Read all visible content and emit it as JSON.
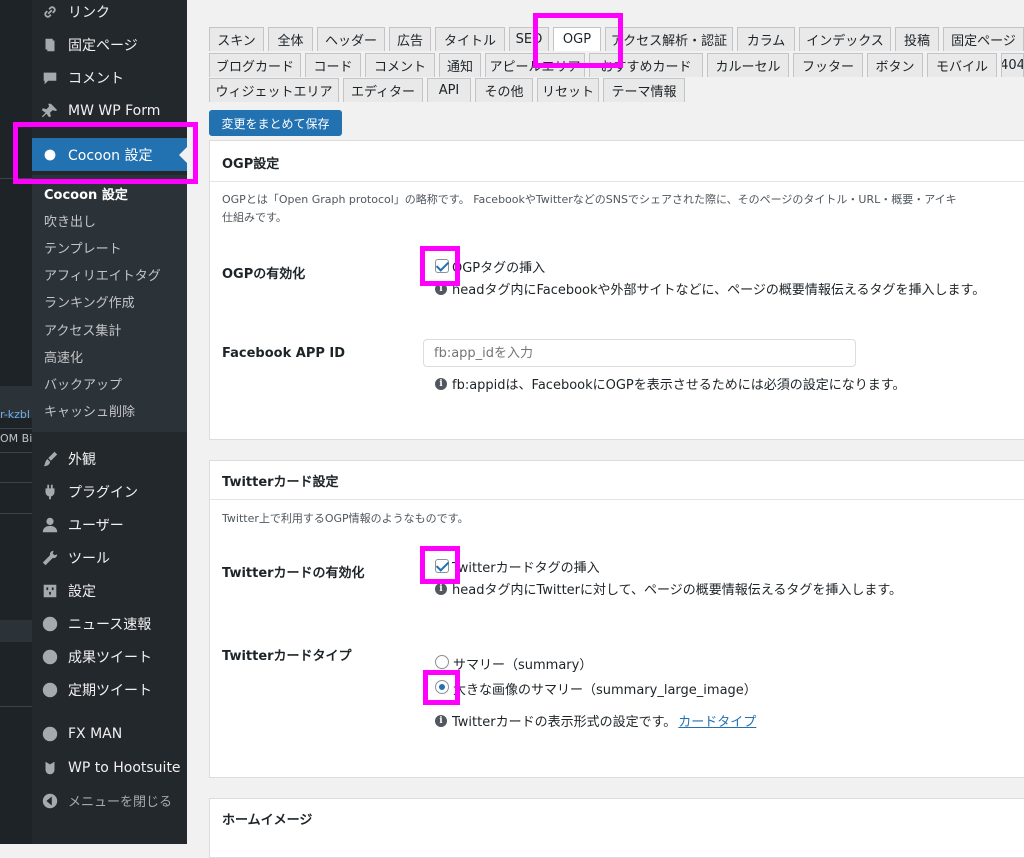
{
  "strip": {
    "text_1": "r-kzbl",
    "text_2": "OM Bi"
  },
  "menu": {
    "items": [
      {
        "label": "リンク",
        "icon": "link-icon"
      },
      {
        "label": "固定ページ",
        "icon": "page-icon"
      },
      {
        "label": "コメント",
        "icon": "comment-icon"
      },
      {
        "label": "MW WP Form",
        "icon": "pin-icon"
      },
      {
        "label": "Cocoon 設定",
        "icon": "circle-icon"
      },
      {
        "label": "外観",
        "icon": "brush-icon"
      },
      {
        "label": "プラグイン",
        "icon": "plugin-icon"
      },
      {
        "label": "ユーザー",
        "icon": "user-icon"
      },
      {
        "label": "ツール",
        "icon": "wrench-icon"
      },
      {
        "label": "設定",
        "icon": "settings-icon"
      },
      {
        "label": "ニュース速報",
        "icon": "globe-icon"
      },
      {
        "label": "成果ツイート",
        "icon": "globe-icon"
      },
      {
        "label": "定期ツイート",
        "icon": "globe-icon"
      },
      {
        "label": "FX MAN",
        "icon": "globe-icon"
      },
      {
        "label": "WP to Hootsuite",
        "icon": "hootsuite-icon"
      },
      {
        "label": "メニューを閉じる",
        "icon": "collapse-icon"
      }
    ],
    "submenu": [
      "Cocoon 設定",
      "吹き出し",
      "テンプレート",
      "アフィリエイトタグ",
      "ランキング作成",
      "アクセス集計",
      "高速化",
      "バックアップ",
      "キャッシュ削除"
    ]
  },
  "tabs": {
    "row1": [
      "スキン",
      "全体",
      "ヘッダー",
      "広告",
      "タイトル",
      "SEO",
      "OGP",
      "アクセス解析・認証",
      "カラム",
      "インデックス",
      "投稿",
      "固定ページ"
    ],
    "row2": [
      "ブログカード",
      "コード",
      "コメント",
      "通知",
      "アピールエリア",
      "おすすめカード",
      "カルーセル",
      "フッター",
      "ボタン",
      "モバイル",
      "404"
    ],
    "row3": [
      "ウィジェットエリア",
      "エディター",
      "API",
      "その他",
      "リセット",
      "テーマ情報"
    ],
    "active": "OGP"
  },
  "save_button": "変更をまとめて保存",
  "ogp": {
    "title": "OGP設定",
    "desc_line1": "OGPとは「Open Graph protocol」の略称です。 FacebookやTwitterなどのSNSでシェアされた際に、そのページのタイトル・URL・概要・アイキ",
    "desc_line2": "仕組みです。",
    "enable_label": "OGPの有効化",
    "enable_checkbox": "OGPタグの挿入",
    "enable_checked": true,
    "enable_hint": "headタグ内にFacebookや外部サイトなどに、ページの概要情報伝えるタグを挿入します。",
    "app_id_label": "Facebook APP ID",
    "app_id_placeholder": "fb:app_idを入力",
    "app_id_value": "",
    "app_id_hint": "fb:appidは、FacebookにOGPを表示させるためには必須の設定になります。"
  },
  "twitter": {
    "title": "Twitterカード設定",
    "desc": "Twitter上で利用するOGP情報のようなものです。",
    "enable_label": "Twitterカードの有効化",
    "enable_checkbox": "Twitterカードタグの挿入",
    "enable_checked": true,
    "enable_hint": "headタグ内にTwitterに対して、ページの概要情報伝えるタグを挿入します。",
    "type_label": "Twitterカードタイプ",
    "options": [
      "サマリー（summary）",
      "大きな画像のサマリー（summary_large_image）"
    ],
    "selected_option": "大きな画像のサマリー（summary_large_image）",
    "type_hint": "Twitterカードの表示形式の設定です。",
    "type_link": "カードタイプ"
  },
  "home_image": {
    "title": "ホームイメージ"
  },
  "colors": {
    "highlight": "#ff00ff",
    "accent": "#2271b1",
    "menu_bg": "#23282d"
  }
}
